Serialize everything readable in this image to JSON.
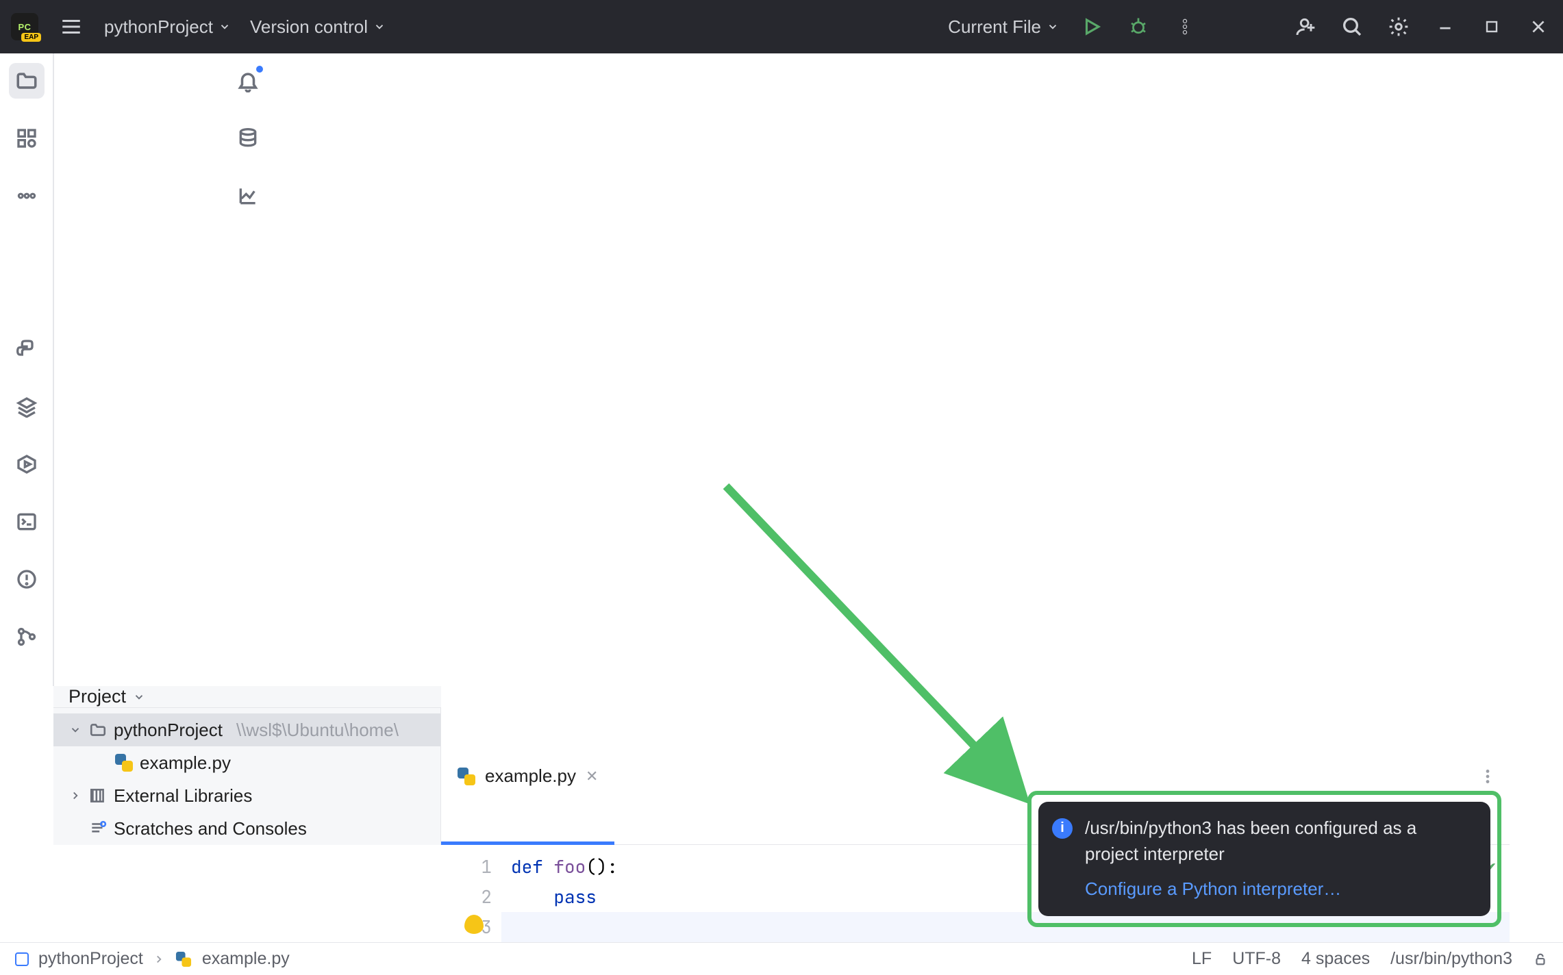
{
  "titlebar": {
    "project_name": "pythonProject",
    "vcs_label": "Version control",
    "run_config": "Current File"
  },
  "sidebar": {
    "header": "Project",
    "tree": {
      "root": {
        "label": "pythonProject",
        "path": "\\\\wsl$\\Ubuntu\\home\\"
      },
      "file": {
        "label": "example.py"
      },
      "ext_libs": "External Libraries",
      "scratches": "Scratches and Consoles"
    }
  },
  "tabs": {
    "active": "example.py"
  },
  "editor": {
    "lines": {
      "1_def": "def",
      "1_name": "foo",
      "1_tail": "():",
      "2_pass": "pass"
    },
    "line_numbers": [
      "1",
      "2",
      "3"
    ]
  },
  "notification": {
    "message": "/usr/bin/python3 has been configured as a project interpreter",
    "link": "Configure a Python interpreter…"
  },
  "breadcrumbs": {
    "root": "pythonProject",
    "file": "example.py"
  },
  "statusbar": {
    "eol": "LF",
    "encoding": "UTF-8",
    "indent": "4 spaces",
    "interpreter": "/usr/bin/python3"
  }
}
